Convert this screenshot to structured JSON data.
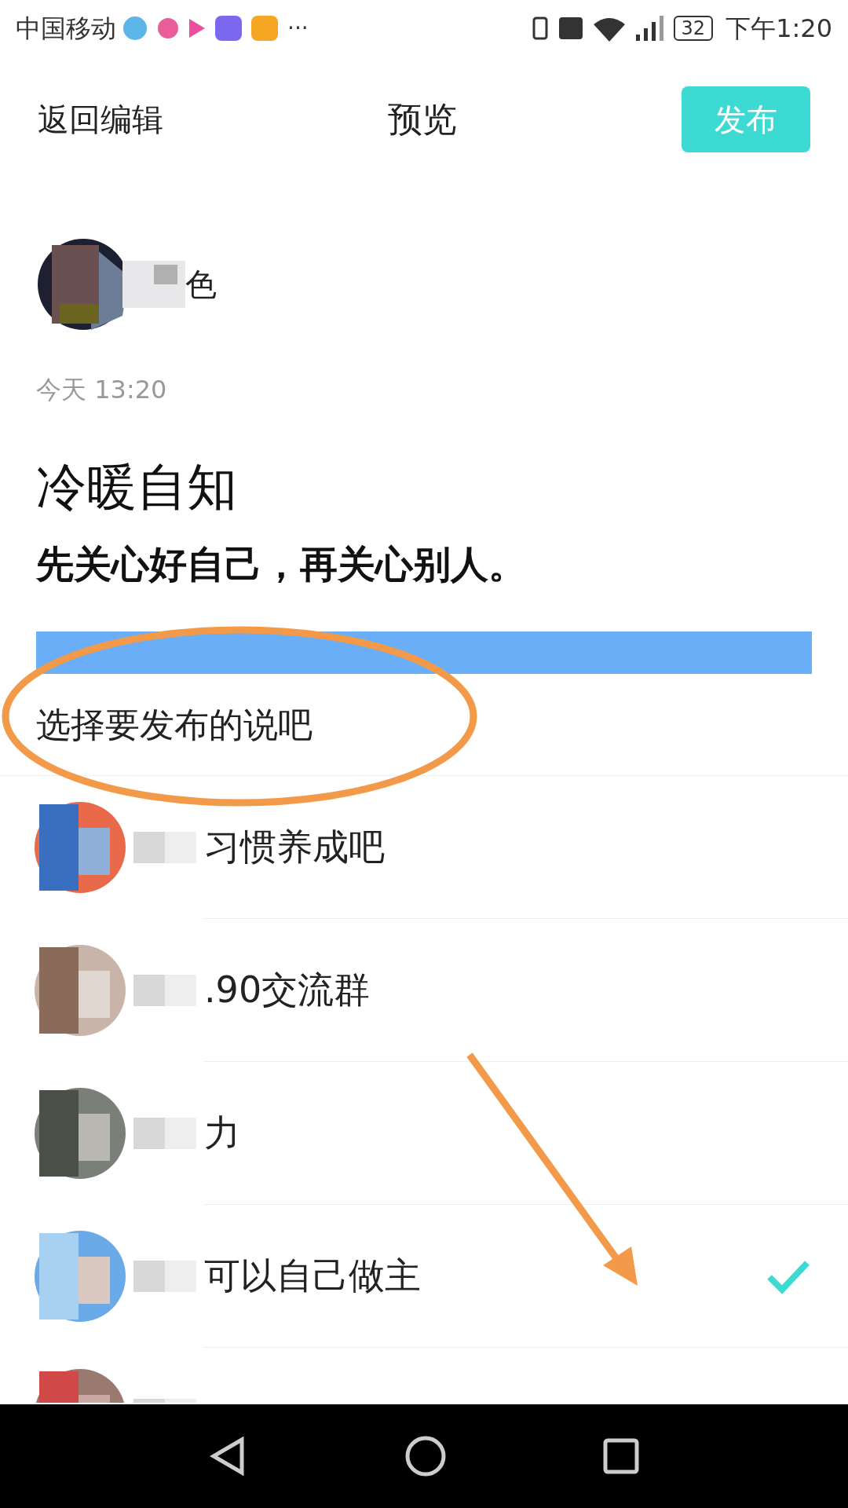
{
  "status_bar": {
    "carrier": "中国移动",
    "battery": "32",
    "time": "下午1:20",
    "more": "···"
  },
  "header": {
    "back": "返回编辑",
    "title": "预览",
    "publish": "发布"
  },
  "post": {
    "author": "色",
    "time": "今天 13:20",
    "title": "冷暖自知",
    "body": "先关心好自己，再关心别人。"
  },
  "section_label": "选择要发布的说吧",
  "groups": [
    {
      "name": "习惯养成吧",
      "selected": false
    },
    {
      "name": ".90交流群",
      "selected": false
    },
    {
      "name": "力",
      "selected": false
    },
    {
      "name": "可以自己做主",
      "selected": true
    },
    {
      "selected": false
    }
  ]
}
